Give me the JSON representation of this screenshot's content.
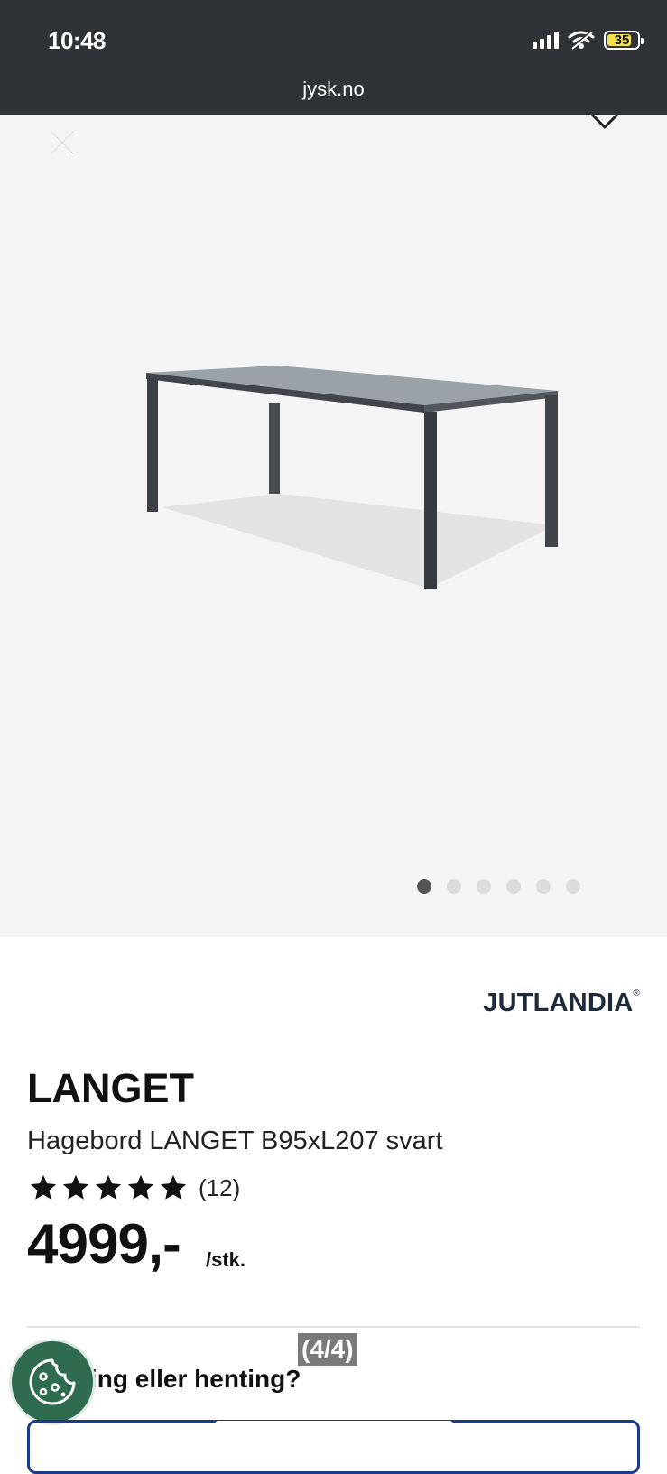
{
  "status_bar": {
    "time": "10:48",
    "battery_level": "35",
    "url": "jysk.no"
  },
  "gallery": {
    "image_count": 6,
    "active_index": 0
  },
  "product": {
    "brand": "JUTLANDIA",
    "brand_mark": "®",
    "title": "LANGET",
    "subtitle": "Hagebord LANGET B95xL207 svart",
    "rating_stars": 5,
    "rating_count": "(12)",
    "price": "4999,-",
    "unit": "/stk."
  },
  "overlay": {
    "page_indicator": "(4/4)"
  },
  "delivery": {
    "question_visible": "ing eller henting?"
  },
  "colors": {
    "status_bar_bg": "#2f3337",
    "gallery_bg": "#f4f4f4",
    "cookie_button_bg": "#2e6b4f",
    "option_border": "#1b3a8a",
    "battery_fill": "#f4e04d"
  }
}
